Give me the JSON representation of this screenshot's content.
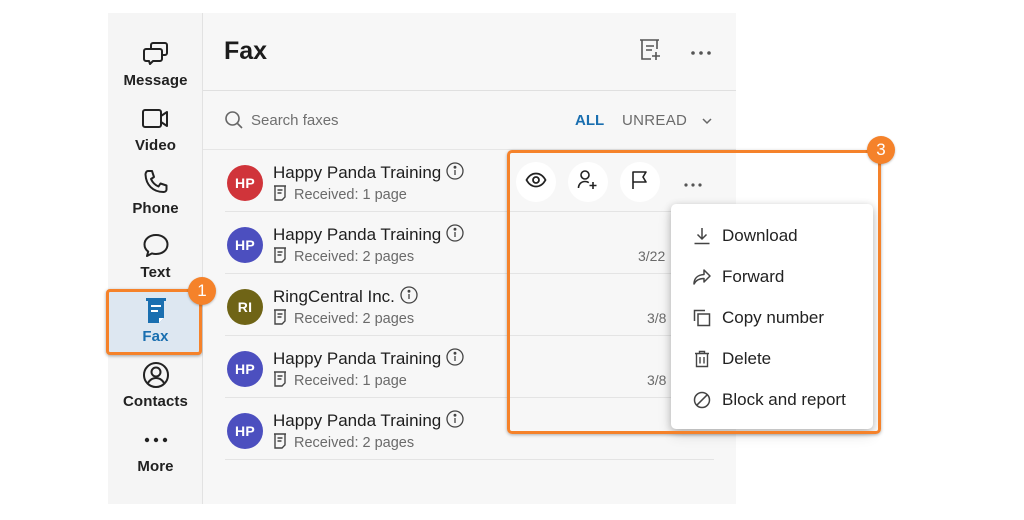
{
  "sidebar": {
    "items": [
      {
        "id": "message",
        "label": "Message",
        "icon": "message-icon"
      },
      {
        "id": "video",
        "label": "Video",
        "icon": "video-icon"
      },
      {
        "id": "phone",
        "label": "Phone",
        "icon": "phone-icon"
      },
      {
        "id": "text",
        "label": "Text",
        "icon": "text-bubble-icon"
      },
      {
        "id": "fax",
        "label": "Fax",
        "icon": "fax-icon",
        "active": true
      },
      {
        "id": "contacts",
        "label": "Contacts",
        "icon": "contacts-icon"
      },
      {
        "id": "more",
        "label": "More",
        "icon": "more-dots-icon"
      }
    ]
  },
  "header": {
    "title": "Fax",
    "new_fax_icon": "new-fax-icon",
    "more_icon": "more-horizontal-icon"
  },
  "search": {
    "placeholder": "Search faxes",
    "value": ""
  },
  "filters": {
    "all_label": "ALL",
    "unread_label": "UNREAD",
    "selected": "ALL"
  },
  "fax_list": [
    {
      "initials": "HP",
      "name": "Happy Panda Training",
      "status": "Received: 1 page",
      "date": "",
      "avatar_color": "#d0343a"
    },
    {
      "initials": "HP",
      "name": "Happy Panda Training",
      "status": "Received: 2 pages",
      "date": "3/22",
      "avatar_color": "#4c4fbf"
    },
    {
      "initials": "RI",
      "name": "RingCentral Inc.",
      "status": "Received: 2 pages",
      "date": "3/8",
      "avatar_color": "#6f6416"
    },
    {
      "initials": "HP",
      "name": "Happy Panda Training",
      "status": "Received: 1 page",
      "date": "3/8",
      "avatar_color": "#4c4fbf"
    },
    {
      "initials": "HP",
      "name": "Happy Panda Training",
      "status": "Received: 2 pages",
      "date": "",
      "avatar_color": "#4c4fbf"
    }
  ],
  "row_actions": {
    "view_icon": "eye-icon",
    "add_contact_icon": "add-contact-icon",
    "flag_icon": "flag-icon",
    "more_icon": "more-horizontal-icon"
  },
  "context_menu": {
    "items": [
      {
        "label": "Download",
        "icon": "download-icon"
      },
      {
        "label": "Forward",
        "icon": "forward-icon"
      },
      {
        "label": "Copy number",
        "icon": "copy-icon"
      },
      {
        "label": "Delete",
        "icon": "trash-icon"
      },
      {
        "label": "Block and report",
        "icon": "block-icon"
      }
    ]
  },
  "annotations": {
    "badge_1": "1",
    "badge_3": "3",
    "accent_color": "#f5822a"
  },
  "colors": {
    "brand_blue": "#1a6fb0"
  }
}
